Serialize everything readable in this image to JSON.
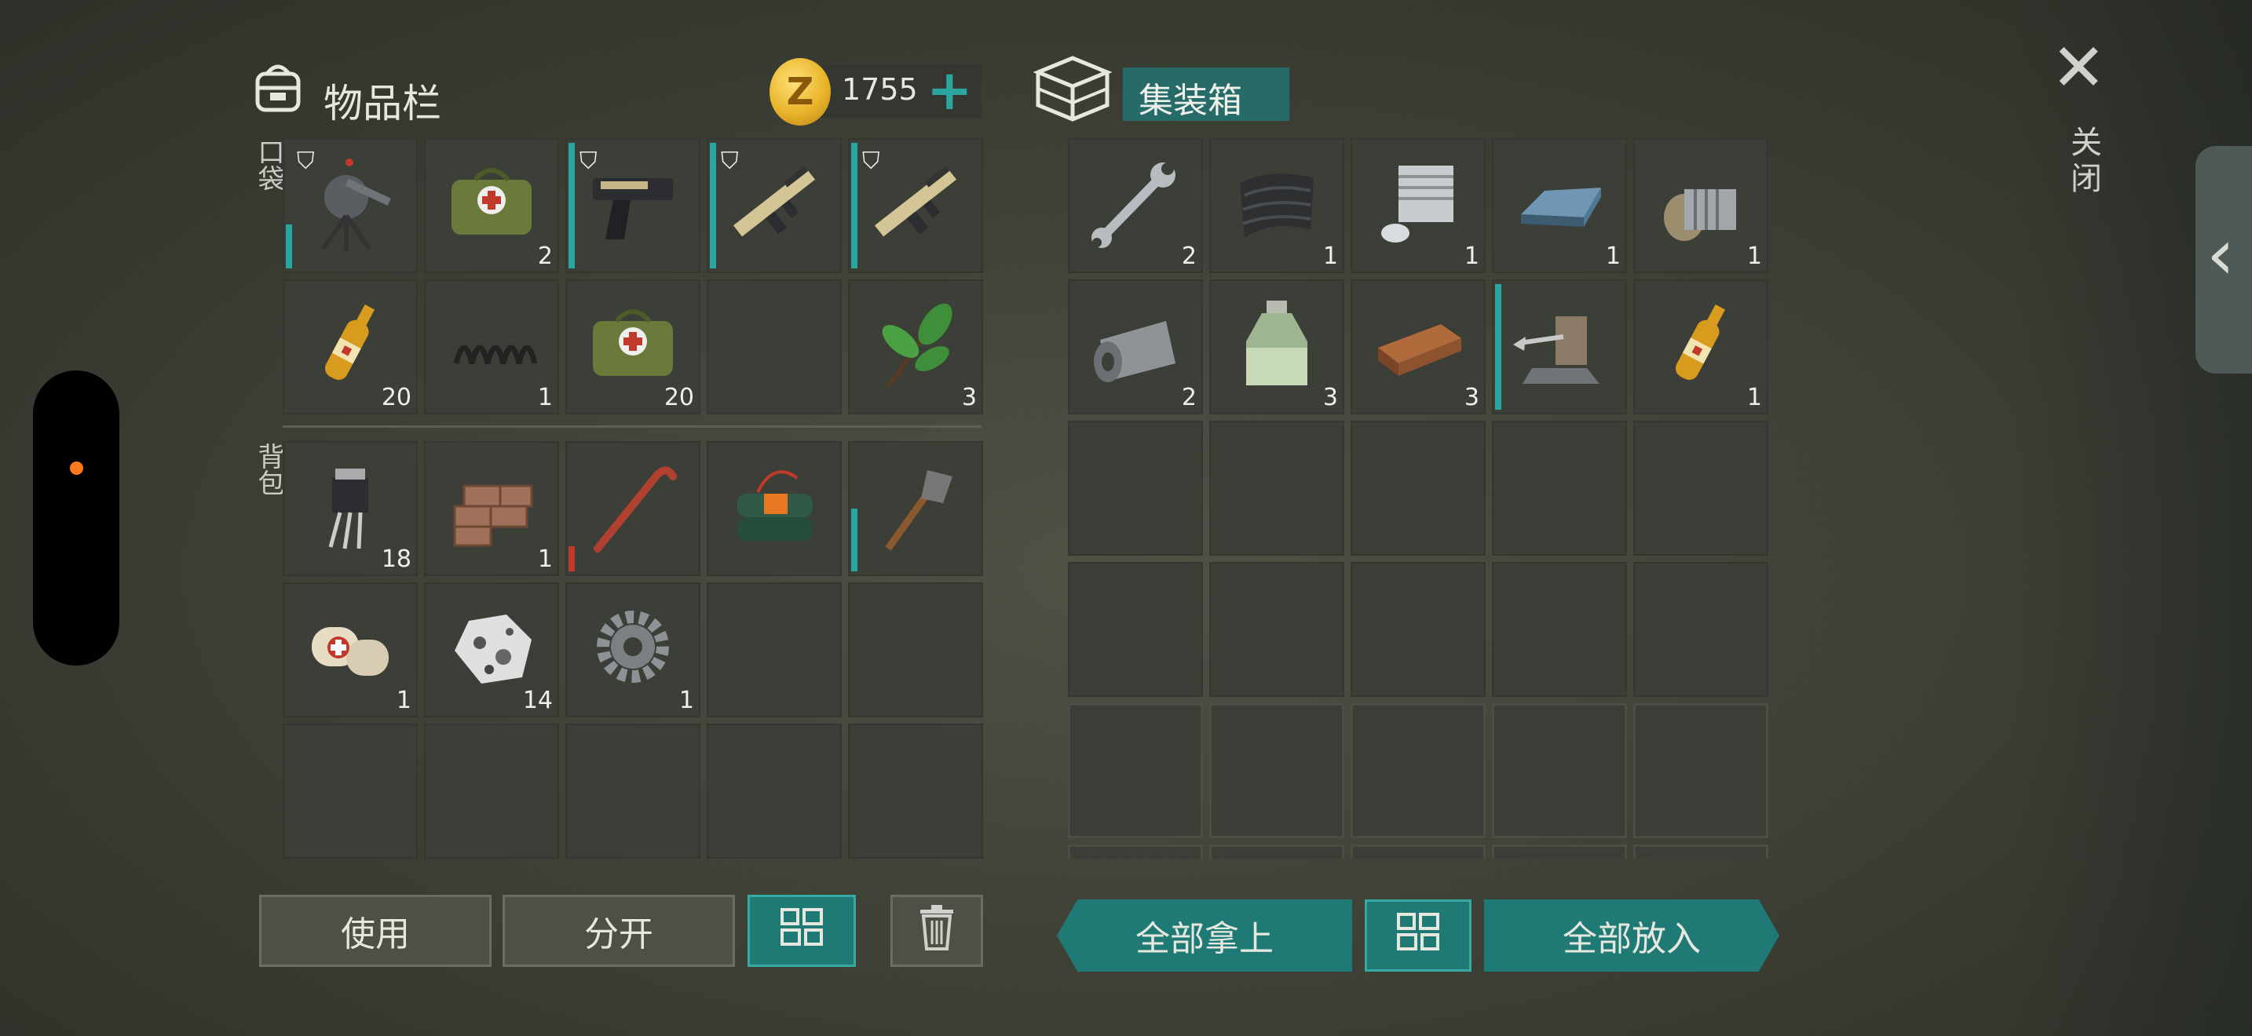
{
  "inventory": {
    "title": "物品栏",
    "coins": "1755",
    "coin_symbol": "Z",
    "pocket_label": "口袋",
    "backpack_label": "背包",
    "pocket": [
      {
        "icon": "turret-icon",
        "qty": "",
        "shield": true,
        "bar_color": "#2aa5a0",
        "bar_level": 0.35
      },
      {
        "icon": "medkit-bag-icon",
        "qty": "2"
      },
      {
        "icon": "pistol-icon",
        "qty": "",
        "shield": true,
        "bar_color": "#2aa5a0",
        "bar_level": 1.0
      },
      {
        "icon": "assault-rifle-icon",
        "qty": "",
        "shield": true,
        "bar_color": "#2aa5a0",
        "bar_level": 1.0
      },
      {
        "icon": "assault-rifle-icon",
        "qty": "",
        "shield": true,
        "bar_color": "#2aa5a0",
        "bar_level": 1.0
      },
      {
        "icon": "ampoule-icon",
        "qty": "20"
      },
      {
        "icon": "spring-icon",
        "qty": "1"
      },
      {
        "icon": "medkit-bag-icon",
        "qty": "20"
      },
      {
        "icon": "",
        "qty": ""
      },
      {
        "icon": "herb-leaf-icon",
        "qty": "3"
      }
    ],
    "backpack": [
      {
        "icon": "transistor-icon",
        "qty": "18"
      },
      {
        "icon": "bricks-icon",
        "qty": "1"
      },
      {
        "icon": "crowbar-icon",
        "qty": "",
        "bar_color": "#c0392b",
        "bar_level": 0.2
      },
      {
        "icon": "explosive-pack-icon",
        "qty": ""
      },
      {
        "icon": "shovel-icon",
        "qty": "",
        "bar_color": "#2aa5a0",
        "bar_level": 0.5
      },
      {
        "icon": "bandage-icon",
        "qty": "1"
      },
      {
        "icon": "ore-stone-icon",
        "qty": "14"
      },
      {
        "icon": "gear-icon",
        "qty": "1"
      },
      {
        "icon": "",
        "qty": ""
      },
      {
        "icon": "",
        "qty": ""
      },
      {
        "icon": "",
        "qty": ""
      },
      {
        "icon": "",
        "qty": ""
      },
      {
        "icon": "",
        "qty": ""
      },
      {
        "icon": "",
        "qty": ""
      },
      {
        "icon": "",
        "qty": ""
      }
    ],
    "buttons": {
      "use": "使用",
      "split": "分开"
    }
  },
  "container": {
    "title": "集装箱",
    "items": [
      {
        "icon": "wrench-icon",
        "qty": "2"
      },
      {
        "icon": "carbon-fabric-icon",
        "qty": "1"
      },
      {
        "icon": "engine-cylinder-icon",
        "qty": "1"
      },
      {
        "icon": "metal-ingot-icon",
        "qty": "1"
      },
      {
        "icon": "gearbox-icon",
        "qty": "1"
      },
      {
        "icon": "metal-roll-icon",
        "qty": "2"
      },
      {
        "icon": "acid-bottle-icon",
        "qty": "3"
      },
      {
        "icon": "wood-plank-icon",
        "qty": "3"
      },
      {
        "icon": "harpoon-turret-icon",
        "qty": "",
        "bar_color": "#2aa5a0",
        "bar_level": 1.0
      },
      {
        "icon": "ampoule-icon",
        "qty": "1"
      }
    ],
    "empty_slots": 10,
    "locked_slots": 10,
    "buttons": {
      "take_all": "全部拿上",
      "put_all": "全部放入"
    }
  },
  "close_label": "关闭",
  "colors": {
    "accent_teal": "#2aa5a0",
    "durability_red": "#c0392b",
    "coin_gold": "#e9b429"
  }
}
